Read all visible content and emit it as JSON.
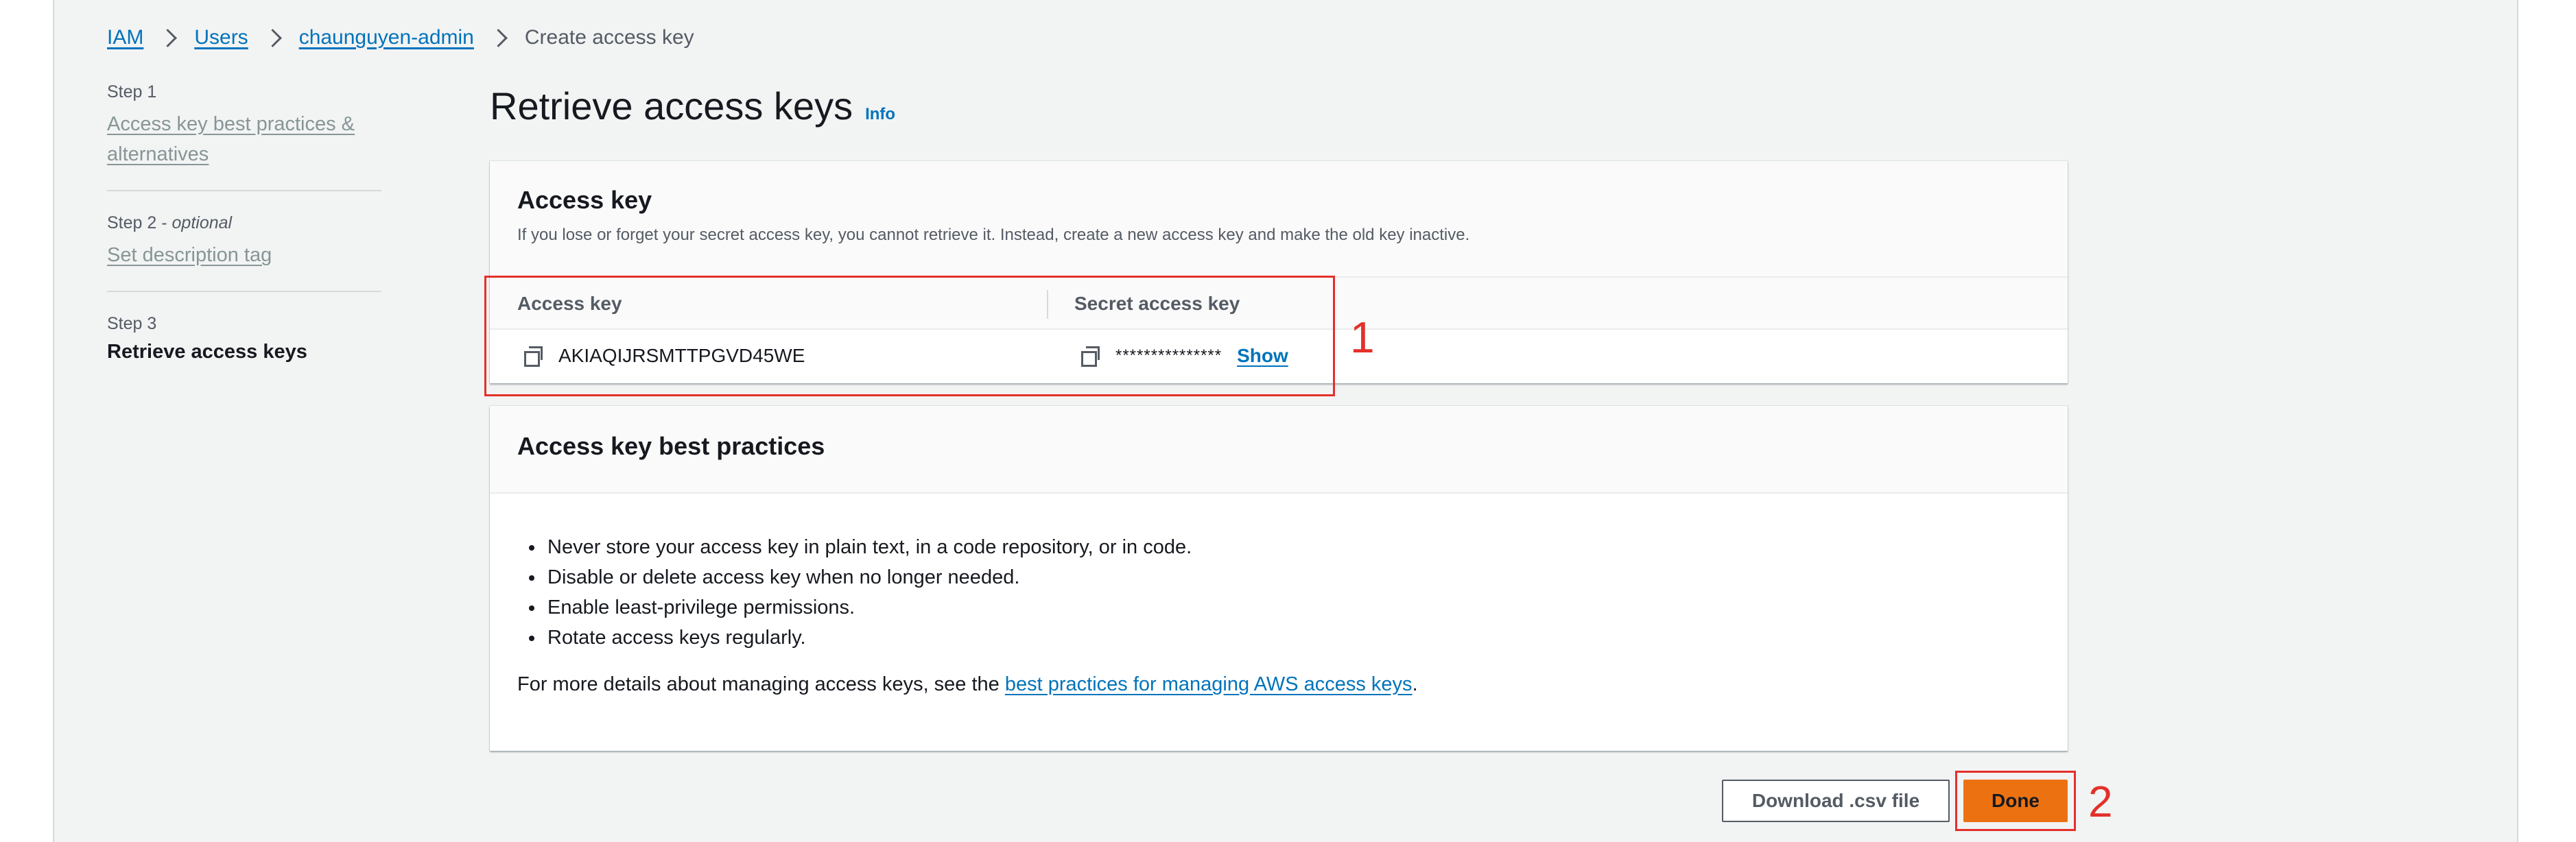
{
  "breadcrumb": {
    "items": [
      "IAM",
      "Users",
      "chaunguyen-admin"
    ],
    "current": "Create access key"
  },
  "steps": [
    {
      "label": "Step 1",
      "optional": "",
      "title": "Access key best practices & alternatives"
    },
    {
      "label": "Step 2 -",
      "optional": "optional",
      "title": "Set description tag"
    },
    {
      "label": "Step 3",
      "optional": "",
      "title": "Retrieve access keys"
    }
  ],
  "page": {
    "title": "Retrieve access keys",
    "info": "Info"
  },
  "access_key_panel": {
    "title": "Access key",
    "description": "If you lose or forget your secret access key, you cannot retrieve it. Instead, create a new access key and make the old key inactive.",
    "col_access_key": "Access key",
    "col_secret_key": "Secret access key",
    "access_key_value": "AKIAQIJRSMTTPGVD45WE",
    "secret_masked": "***************",
    "show_label": "Show"
  },
  "best_practices": {
    "title": "Access key best practices",
    "items": [
      "Never store your access key in plain text, in a code repository, or in code.",
      "Disable or delete access key when no longer needed.",
      "Enable least-privilege permissions.",
      "Rotate access keys regularly."
    ],
    "footer_prefix": "For more details about managing access keys, see the ",
    "footer_link": "best practices for managing AWS access keys",
    "footer_suffix": "."
  },
  "actions": {
    "download": "Download .csv file",
    "done": "Done"
  },
  "annotations": {
    "one": "1",
    "two": "2"
  },
  "colors": {
    "link": "#0073bb",
    "primary_button": "#ec7211",
    "annotation": "#e3302a"
  }
}
